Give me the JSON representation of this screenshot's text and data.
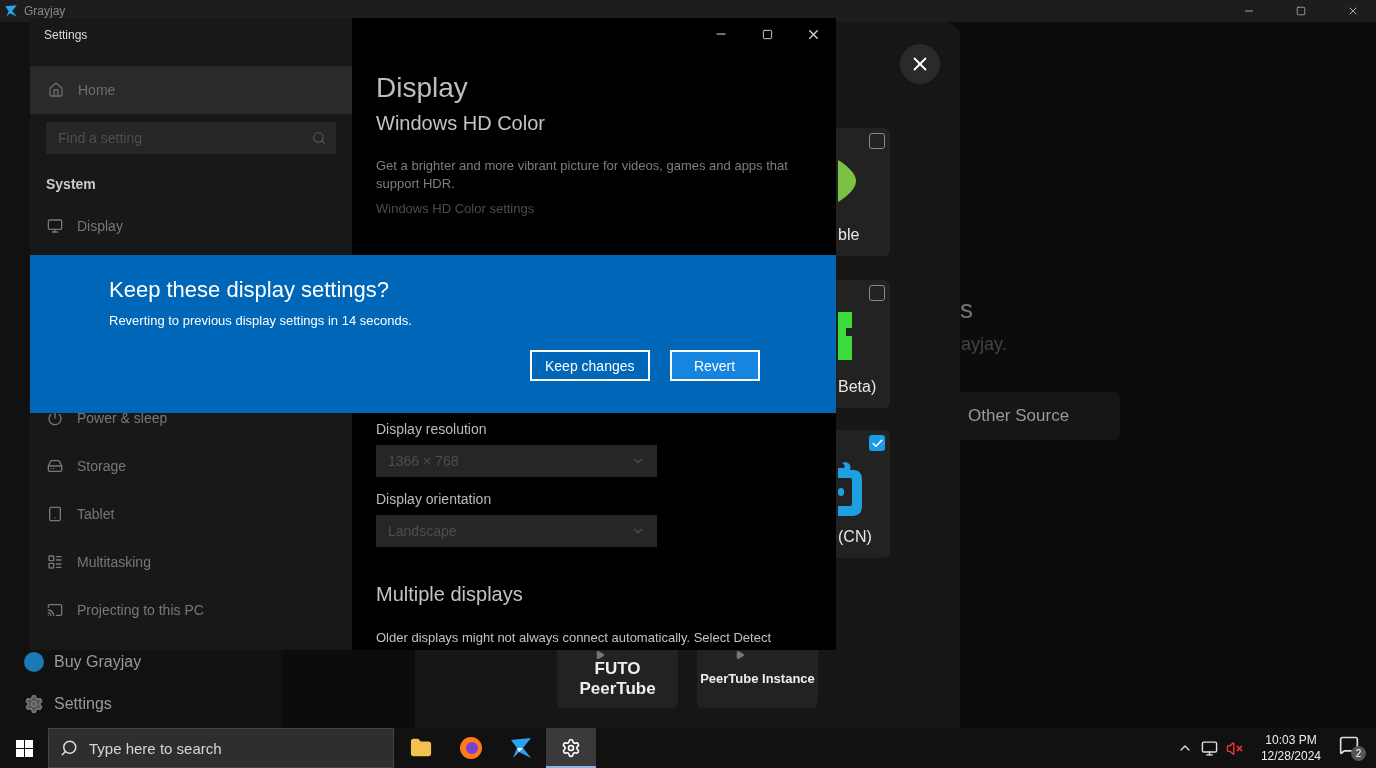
{
  "grayjay": {
    "title": "Grayjay",
    "sidebar": [
      {
        "label": "Buy Grayjay",
        "kind": "buy"
      },
      {
        "label": "Settings",
        "kind": "settings"
      }
    ],
    "page": {
      "heading": "s",
      "subtitle": "ayjay.",
      "button": "Other Source"
    },
    "sources": [
      {
        "label": "ble",
        "kind": "leaf",
        "checked": false
      },
      {
        "label": "Beta)",
        "kind": "blocks",
        "checked": false
      },
      {
        "label": "(CN)",
        "kind": "robot",
        "checked": true
      }
    ],
    "bottom_sources": [
      {
        "label": "FUTO PeerTube",
        "kind": "featured"
      },
      {
        "label": "PeerTube Instance",
        "kind": "instance"
      }
    ]
  },
  "settings": {
    "title": "Settings",
    "home": "Home",
    "search": {
      "placeholder": "Find a setting"
    },
    "section": "System",
    "nav_groups": [
      [
        {
          "label": "Display",
          "kind": "display"
        }
      ],
      [
        {
          "label": "Power & sleep",
          "kind": "power"
        },
        {
          "label": "Storage",
          "kind": "storage"
        },
        {
          "label": "Tablet",
          "kind": "tablet"
        },
        {
          "label": "Multitasking",
          "kind": "multitasking"
        },
        {
          "label": "Projecting to this PC",
          "kind": "projecting"
        }
      ]
    ],
    "heading": "Display",
    "hdr_title": "Windows HD Color",
    "hdr_text": "Get a brighter and more vibrant picture for videos, games and apps that support HDR.",
    "hdr_link": "Windows HD Color settings",
    "fields": [
      {
        "label": "Display resolution",
        "value": "1366 × 768"
      },
      {
        "label": "Display orientation",
        "value": "Landscape"
      }
    ],
    "multi_title": "Multiple displays",
    "multi_text": "Older displays might not always connect automatically. Select Detect"
  },
  "dialog": {
    "title": "Keep these display settings?",
    "text": "Reverting to previous display settings in 14 seconds.",
    "buttons": [
      {
        "label": "Keep changes",
        "primary": false
      },
      {
        "label": "Revert",
        "primary": true
      }
    ]
  },
  "taskbar": {
    "search": {
      "placeholder": "Type here to search"
    },
    "apps": [
      {
        "kind": "explorer",
        "selected": false
      },
      {
        "kind": "firefox",
        "selected": false
      },
      {
        "kind": "grayjay",
        "selected": false
      },
      {
        "kind": "settings",
        "selected": true
      }
    ],
    "time": "10:03 PM",
    "date": "12/28/2024",
    "notifications": "2"
  }
}
